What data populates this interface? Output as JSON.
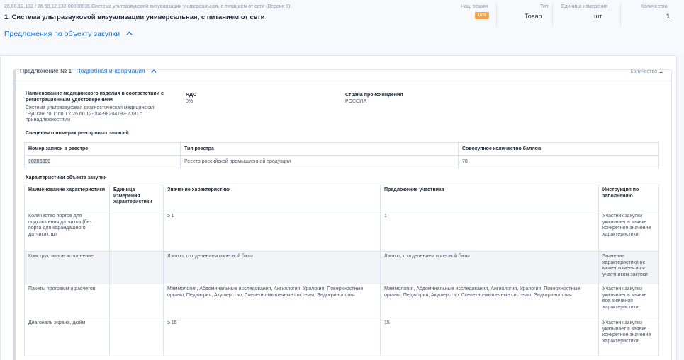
{
  "header": {
    "breadcrumb": "26.60.12.132 / 26.60.12.132-00000036 Система ультразвуковой визуализации универсальная, с питанием от сети (Версия 9)",
    "title": "1. Система ультразвуковой визуализации универсальная, с питанием от сети",
    "offers_link": "Предложения по объекту закупки",
    "meta": {
      "nat_regime_label": "Нац. режим",
      "nat_regime_badge": "1875",
      "type_label": "Тип",
      "type_value": "Товар",
      "unit_label": "Единица измерения",
      "unit_value": "шт",
      "qty_label": "Количество",
      "qty_value": "1"
    }
  },
  "offer": {
    "title": "Предложение № 1",
    "more_link": "Подробная информация",
    "qty_label": "Количество",
    "qty_value": "1",
    "device_name_label": "Наименование медицинского изделия в соответствии с регистрационным удостоверением",
    "device_name_value": "Система ультразвуковая диагностическая медицинская \"РуСкан 70П\" по ТУ 26.60.12-004-98204792-2020 с принадлежностями",
    "vat_label": "НДС",
    "vat_value": "0%",
    "country_label": "Страна происхождения",
    "country_value": "РОССИЯ",
    "registry_section": "Сведения о номерах реестровых записей",
    "registry_headers": [
      "Номер записи в реестре",
      "Тип реестра",
      "Совокупное количество баллов"
    ],
    "registry_row": [
      "10206309",
      "Реестр российской промышленной продукции",
      "70"
    ],
    "chars_section": "Характеристики объекта закупки",
    "chars_headers": [
      "Наименование характеристики",
      "Единица измерения характеристики",
      "Значение характеристики",
      "Предложение участника",
      "Инструкция по заполнению"
    ],
    "chars_rows": [
      [
        "Количество портов для подключения датчиков (без порта для карандашного датчика), шт",
        "",
        "≥ 1",
        "1",
        "Участник закупки указывает в заявке конкретное значение характеристики"
      ],
      [
        "Конструктивное исполнение",
        "",
        "Лэптоп, с отделением колесной базы",
        "Лэптоп, с отделением колесной базы",
        "Значение характеристики не может изменяться участником закупки"
      ],
      [
        "Пакеты программ и расчетов",
        "",
        "Маммология, Абдоминальные исследования, Ангиология, Урология, Поверхностные органы, Педиатрия, Акушерство, Скелетно-мышечные системы, Эндокринология",
        "Маммология, Абдоминальные исследования, Ангиология, Урология, Поверхностные органы, Педиатрия, Акушерство, Скелетно-мышечные системы, Эндокринология",
        "Участник закупки указывает в заявке все значения характеристики"
      ],
      [
        "Диагональ экрана, дюйм",
        "",
        "≥ 15",
        "15",
        "Участник закупки указывает в заявке конкретное значение характеристики"
      ]
    ]
  }
}
